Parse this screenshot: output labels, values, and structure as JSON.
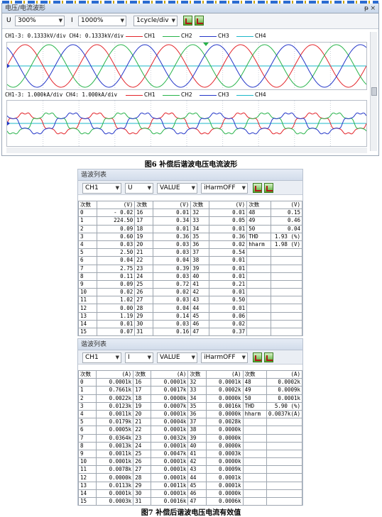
{
  "window1": {
    "title": "电压/电流波形",
    "pin": "ᵽ",
    "close": "×",
    "toolbar": {
      "u_label": "U",
      "u_scale": "300%",
      "i_label": "I",
      "i_scale": "1000%",
      "timebase": "1cycle/div"
    },
    "plot1_scale": "CH1-3: 0.1333kV/div  CH4: 0.1333kV/div",
    "plot2_scale": "CH1-3: 1.000kA/div  CH4: 1.000kA/div",
    "legend": [
      "CH1",
      "CH2",
      "CH3",
      "CH4"
    ],
    "colors": {
      "CH1": "#e3252b",
      "CH2": "#27b34a",
      "CH3": "#2336c8",
      "CH4": "#1bb7c9"
    }
  },
  "caption6": "图6 补偿后谐波电压电流波形",
  "caption7": "图7 补偿后谐波电压电流有效值",
  "harm1": {
    "title": "谐波列表",
    "ch": "CH1",
    "quantity": "U",
    "mode": "VALUE",
    "iharm": "iHarmOFF",
    "headers": [
      "次数",
      "(V)",
      "次数",
      "(V)",
      "次数",
      "(V)",
      "次数",
      "(V)"
    ],
    "rows": [
      [
        "0",
        "- 0.02",
        "16",
        "0.01",
        "32",
        "0.01",
        "48",
        "0.15"
      ],
      [
        "1",
        "224.50",
        "17",
        "0.34",
        "33",
        "0.05",
        "49",
        "0.46"
      ],
      [
        "2",
        "0.09",
        "18",
        "0.01",
        "34",
        "0.01",
        "50",
        "0.04"
      ],
      [
        "3",
        "0.60",
        "19",
        "0.36",
        "35",
        "0.36",
        "THD",
        "1.93 (%)"
      ],
      [
        "4",
        "0.03",
        "20",
        "0.03",
        "36",
        "0.02",
        "hharm",
        "1.98 (V)"
      ],
      [
        "5",
        "2.50",
        "21",
        "0.03",
        "37",
        "0.54",
        "",
        ""
      ],
      [
        "6",
        "0.04",
        "22",
        "0.04",
        "38",
        "0.01",
        "",
        ""
      ],
      [
        "7",
        "2.75",
        "23",
        "0.39",
        "39",
        "0.01",
        "",
        ""
      ],
      [
        "8",
        "0.11",
        "24",
        "0.03",
        "40",
        "0.01",
        "",
        ""
      ],
      [
        "9",
        "0.09",
        "25",
        "0.72",
        "41",
        "0.21",
        "",
        ""
      ],
      [
        "10",
        "0.02",
        "26",
        "0.02",
        "42",
        "0.01",
        "",
        ""
      ],
      [
        "11",
        "1.02",
        "27",
        "0.03",
        "43",
        "0.50",
        "",
        ""
      ],
      [
        "12",
        "0.00",
        "28",
        "0.04",
        "44",
        "0.01",
        "",
        ""
      ],
      [
        "13",
        "1.19",
        "29",
        "0.14",
        "45",
        "0.06",
        "",
        ""
      ],
      [
        "14",
        "0.01",
        "30",
        "0.03",
        "46",
        "0.02",
        "",
        ""
      ],
      [
        "15",
        "0.07",
        "31",
        "0.16",
        "47",
        "0.37",
        "",
        ""
      ]
    ]
  },
  "harm2": {
    "title": "谐波列表",
    "ch": "CH1",
    "quantity": "I",
    "mode": "VALUE",
    "iharm": "iHarmOFF",
    "headers": [
      "次数",
      "(A)",
      "次数",
      "(A)",
      "次数",
      "(A)",
      "次数",
      "(A)"
    ],
    "rows": [
      [
        "0",
        "0.0001k",
        "16",
        "0.0001k",
        "32",
        "0.0001k",
        "48",
        "0.0002k"
      ],
      [
        "1",
        "0.7661k",
        "17",
        "0.0017k",
        "33",
        "0.0002k",
        "49",
        "0.0009k"
      ],
      [
        "2",
        "0.0022k",
        "18",
        "0.0000k",
        "34",
        "0.0000k",
        "50",
        "0.0001k"
      ],
      [
        "3",
        "0.0123k",
        "19",
        "0.0007k",
        "35",
        "0.0016k",
        "THD",
        "5.90 (%)"
      ],
      [
        "4",
        "0.0011k",
        "20",
        "0.0001k",
        "36",
        "0.0000k",
        "hharm",
        "0.0037k(A)"
      ],
      [
        "5",
        "0.0179k",
        "21",
        "0.0004k",
        "37",
        "0.0028k",
        "",
        ""
      ],
      [
        "6",
        "0.0005k",
        "22",
        "0.0001k",
        "38",
        "0.0000k",
        "",
        ""
      ],
      [
        "7",
        "0.0364k",
        "23",
        "0.0032k",
        "39",
        "0.0000k",
        "",
        ""
      ],
      [
        "8",
        "0.0013k",
        "24",
        "0.0001k",
        "40",
        "0.0000k",
        "",
        ""
      ],
      [
        "9",
        "0.0011k",
        "25",
        "0.0047k",
        "41",
        "0.0003k",
        "",
        ""
      ],
      [
        "10",
        "0.0001k",
        "26",
        "0.0001k",
        "42",
        "0.0000k",
        "",
        ""
      ],
      [
        "11",
        "0.0078k",
        "27",
        "0.0001k",
        "43",
        "0.0009k",
        "",
        ""
      ],
      [
        "12",
        "0.0000k",
        "28",
        "0.0001k",
        "44",
        "0.0001k",
        "",
        ""
      ],
      [
        "13",
        "0.0113k",
        "29",
        "0.0011k",
        "45",
        "0.0001k",
        "",
        ""
      ],
      [
        "14",
        "0.0001k",
        "30",
        "0.0001k",
        "46",
        "0.0000k",
        "",
        ""
      ],
      [
        "15",
        "0.0003k",
        "31",
        "0.0016k",
        "47",
        "0.0006k",
        "",
        ""
      ]
    ]
  }
}
